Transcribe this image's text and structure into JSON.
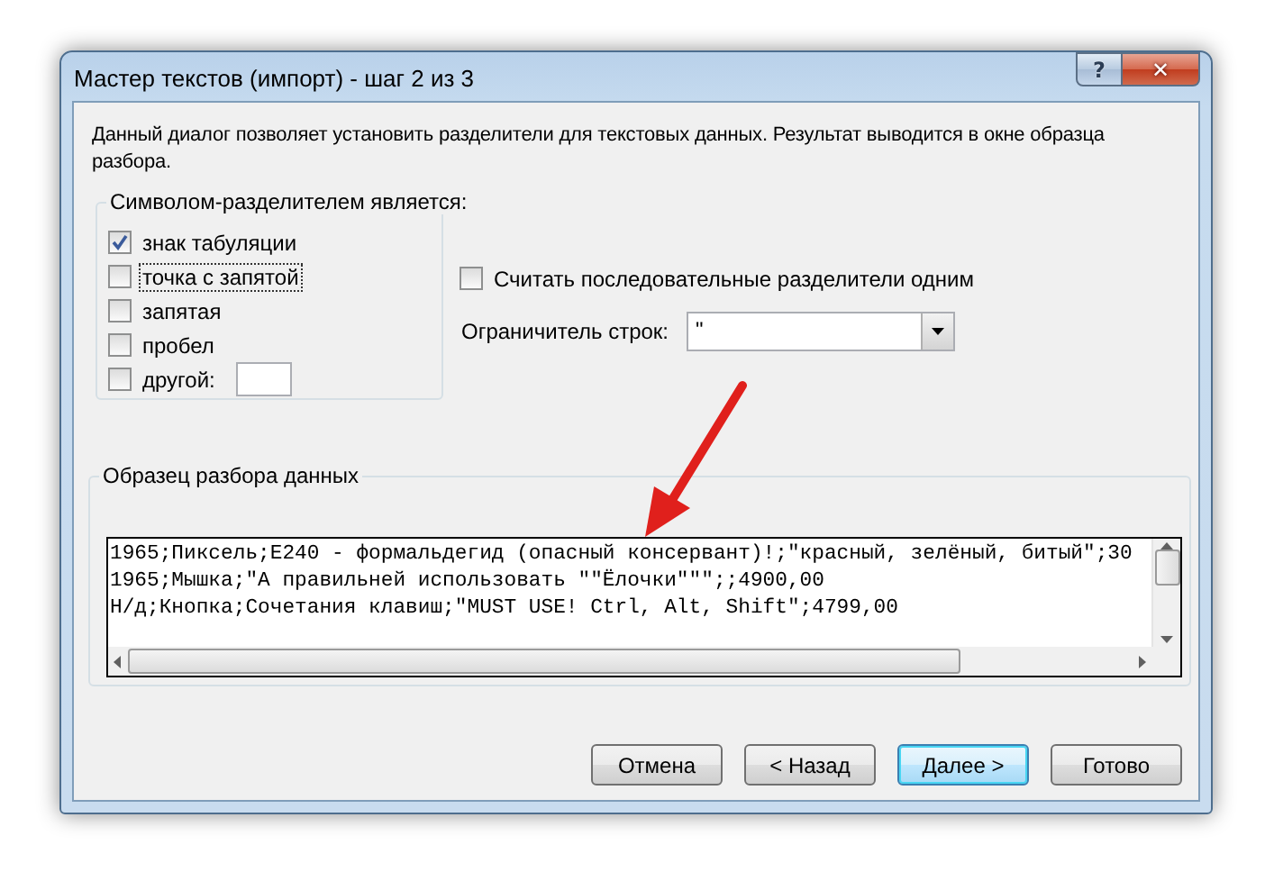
{
  "window": {
    "title": "Мастер текстов (импорт) - шаг 2 из 3"
  },
  "title_buttons": [
    {
      "kind": "help",
      "label": "?"
    },
    {
      "kind": "close",
      "label": "✕"
    }
  ],
  "description": "Данный диалог позволяет установить разделители для текстовых данных. Результат выводится в окне образца разбора.",
  "delimiters": {
    "legend": "Символом-разделителем является:",
    "options": [
      {
        "kind": "checkbox",
        "label": "знак табуляции",
        "checked": true,
        "focused": false
      },
      {
        "kind": "checkbox",
        "label": "точка с запятой",
        "checked": false,
        "focused": true
      },
      {
        "kind": "checkbox",
        "label": "запятая",
        "checked": false,
        "focused": false
      },
      {
        "kind": "checkbox",
        "label": "пробел",
        "checked": false,
        "focused": false
      },
      {
        "kind": "checkbox-field",
        "label": "другой:",
        "checked": false,
        "focused": false
      }
    ]
  },
  "consecutive": {
    "label": "Считать последовательные разделители одним",
    "checked": false
  },
  "text_qualifier": {
    "label": "Ограничитель строк:",
    "value": "\""
  },
  "preview": {
    "legend": "Образец разбора данных",
    "lines": [
      "1965;Пиксель;E240 - формальдегид (опасный консервант)!;\"красный, зелёный, битый\";30",
      "1965;Мышка;\"А правильней использовать \"\"Ёлочки\"\"\";;4900,00",
      "Н/д;Кнопка;Сочетания клавиш;\"MUST USE! Ctrl, Alt, Shift\";4799,00"
    ]
  },
  "buttons": [
    {
      "label": "Отмена",
      "default": false
    },
    {
      "label": "< Назад",
      "default": false
    },
    {
      "label": "Далее >",
      "default": true
    },
    {
      "label": "Готово",
      "default": false
    }
  ]
}
